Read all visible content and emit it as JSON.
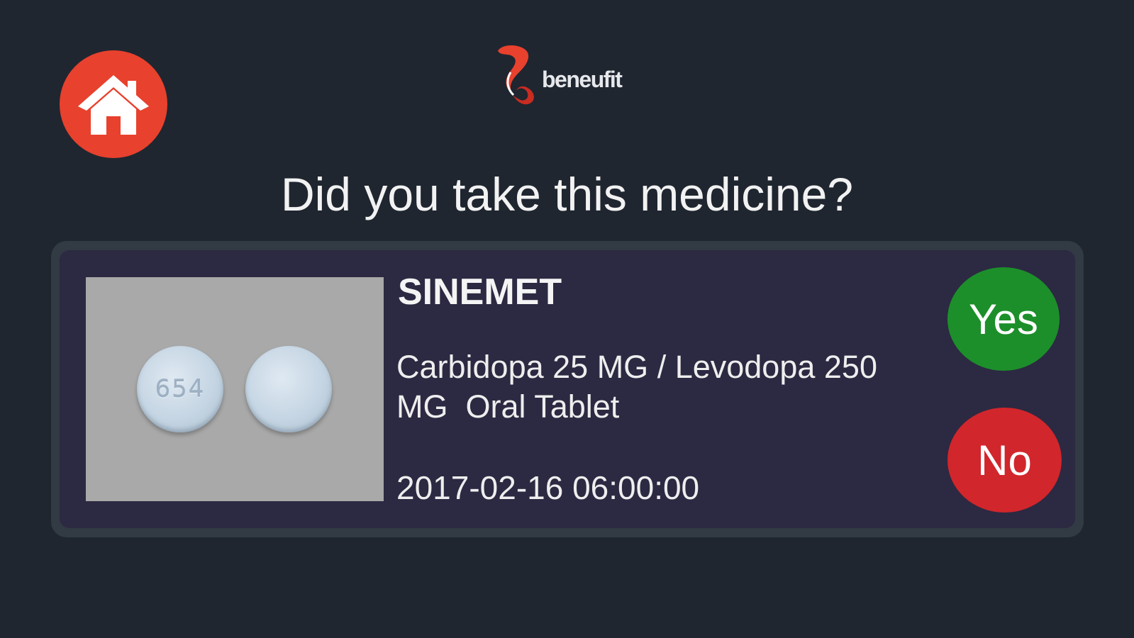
{
  "header": {
    "home_icon": "home-icon",
    "logo": {
      "text": "beneufit",
      "colors": {
        "mark_primary": "#e8412d",
        "mark_secondary": "#c92c20"
      }
    }
  },
  "prompt": {
    "question": "Did you take this medicine?"
  },
  "medication": {
    "name": "SINEMET",
    "description": "Carbidopa 25 MG / Levodopa 250\nMG  Oral Tablet",
    "scheduled_time": "2017-02-16 06:00:00",
    "pill_imprint": "654"
  },
  "actions": {
    "yes_label": "Yes",
    "no_label": "No"
  },
  "colors": {
    "background": "#1f2630",
    "card": "#2c2942",
    "accent": "#e8412d",
    "yes": "#1c8f2a",
    "no": "#d1262b"
  }
}
